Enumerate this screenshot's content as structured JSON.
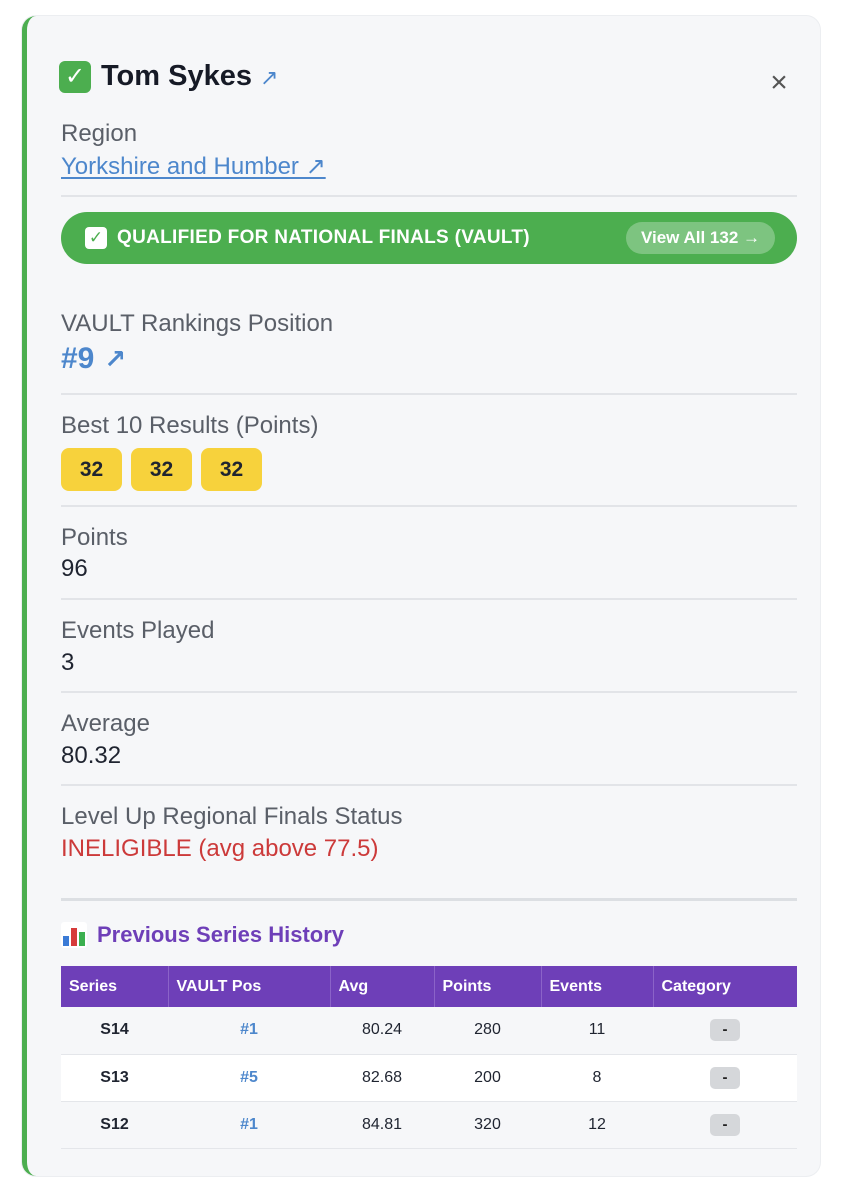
{
  "player": {
    "name": "Tom Sykes",
    "ext_icon": "external-link-arrow"
  },
  "close_label": "×",
  "region": {
    "label": "Region",
    "value": "Yorkshire and Humber ↗"
  },
  "banner": {
    "text": "QUALIFIED FOR NATIONAL FINALS (VAULT)",
    "button": "View All 132 →",
    "color": "#4cae4f"
  },
  "rankings": {
    "label": "VAULT Rankings Position",
    "value": "#9",
    "arrow": "↗"
  },
  "best_results": {
    "label": "Best 10 Results (Points)",
    "values": [
      "32",
      "32",
      "32"
    ]
  },
  "points": {
    "label": "Points",
    "value": "96"
  },
  "events": {
    "label": "Events Played",
    "value": "3"
  },
  "average": {
    "label": "Average",
    "value": "80.32"
  },
  "level_up": {
    "label": "Level Up Regional Finals Status",
    "value": "INELIGIBLE (avg above 77.5)"
  },
  "history": {
    "title": "Previous Series History",
    "columns": [
      "Series",
      "VAULT Pos",
      "Avg",
      "Points",
      "Events",
      "Category"
    ],
    "rows": [
      {
        "series": "S14",
        "pos": "#1",
        "avg": "80.24",
        "points": "280",
        "events": "11",
        "category": "-"
      },
      {
        "series": "S13",
        "pos": "#5",
        "avg": "82.68",
        "points": "200",
        "events": "8",
        "category": "-"
      },
      {
        "series": "S12",
        "pos": "#1",
        "avg": "84.81",
        "points": "320",
        "events": "12",
        "category": "-"
      }
    ]
  },
  "colors": {
    "accent_green": "#4cae4f",
    "link_blue": "#4d87cc",
    "purple": "#6e3fb8",
    "chip_yellow": "#f7d23c",
    "error_red": "#cc3a3a"
  }
}
